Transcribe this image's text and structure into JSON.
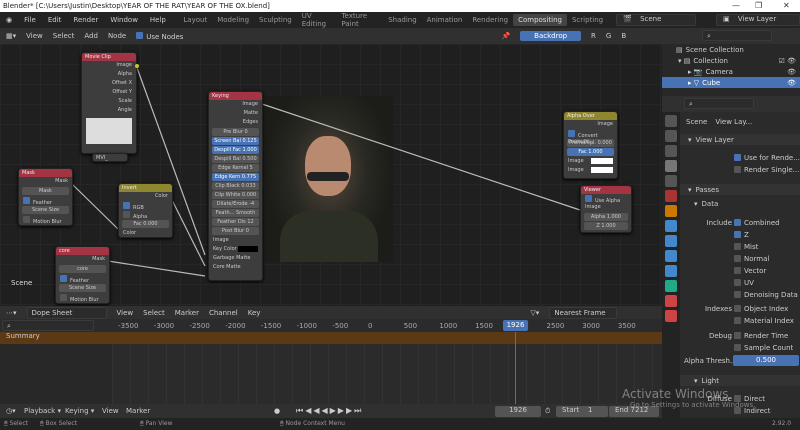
{
  "window_title": "Blender* [C:\\Users\\Justin\\Desktop\\YEAR OF THE RAT\\YEAR OF THE OX.blend]",
  "menu": [
    "File",
    "Edit",
    "Render",
    "Window",
    "Help"
  ],
  "workspaces": [
    "Layout",
    "Modeling",
    "Sculpting",
    "UV Editing",
    "Texture Paint",
    "Shading",
    "Animation",
    "Rendering",
    "Compositing",
    "Scripting"
  ],
  "active_workspace": "Compositing",
  "scene": "Scene",
  "view_layer": "View Layer",
  "node_header": {
    "menus": [
      "View",
      "Select",
      "Add",
      "Node"
    ],
    "use_nodes": "Use Nodes",
    "backdrop": "Backdrop",
    "channels": [
      "R",
      "G",
      "B"
    ]
  },
  "nodes": {
    "movie_clip": {
      "title": "Movie Clip",
      "outputs": [
        "Image",
        "Alpha",
        "Offset X",
        "Offset Y",
        "Scale",
        "Angle"
      ],
      "clip": "MVI_"
    },
    "mask": {
      "title": "Mask",
      "output": "Mask",
      "mask": "Mask",
      "feather": "Feather",
      "size": "Scene Size",
      "motion_blur": "Motion Blur"
    },
    "core": {
      "title": "core",
      "output": "Mask",
      "mask": "core",
      "feather": "Feather",
      "size": "Scene Size",
      "motion_blur": "Motion Blur"
    },
    "invert": {
      "title": "Invert",
      "output": "Color",
      "rgb": "RGB",
      "alpha": "Alpha",
      "fac_label": "Fac",
      "fac": "0.000",
      "input": "Color"
    },
    "keying": {
      "title": "Keying",
      "outputs": [
        "Image",
        "Matte",
        "Edges"
      ],
      "fields": [
        [
          "Pre Blur",
          "0"
        ],
        [
          "Screen Bal",
          "0.125"
        ],
        [
          "Despill Fac",
          "1.000"
        ],
        [
          "Despill Bal",
          "0.500"
        ],
        [
          "Edge Kernel",
          "5"
        ],
        [
          "Edge Kern",
          "0.775"
        ],
        [
          "Clip Black",
          "0.033"
        ],
        [
          "Clip White",
          "0.000"
        ],
        [
          "Dilate/Erode",
          "-4"
        ],
        [
          "Feath...",
          "Smooth"
        ],
        [
          "Feather Dis",
          "12"
        ],
        [
          "Post Blur",
          "0"
        ]
      ],
      "inputs": [
        "Image",
        "Key Color",
        "Garbage Matte",
        "Core Matte"
      ]
    },
    "alpha_over": {
      "title": "Alpha Over",
      "output": "Image",
      "convert": "Convert Premulti...",
      "premul_label": "Premultipl.",
      "premul": "0.000",
      "fac_label": "Fac",
      "fac": "1.000",
      "inputs": [
        "Image",
        "Image"
      ]
    },
    "viewer": {
      "title": "Viewer",
      "use_alpha": "Use Alpha",
      "input": "Image",
      "alpha_label": "Alpha",
      "alpha": "1.000",
      "z_label": "Z",
      "z": "1.000"
    }
  },
  "scene_label": "Scene",
  "outliner": {
    "items": [
      "Scene Collection",
      "Collection",
      "Camera",
      "Cube"
    ]
  },
  "properties": {
    "breadcrumb": [
      "Scene",
      "View Lay..."
    ],
    "view_layer": "View Layer",
    "use_render": "Use for Rende...",
    "render_single": "Render Single...",
    "passes": "Passes",
    "data": "Data",
    "include": "Include",
    "data_passes": [
      [
        "Combined",
        true
      ],
      [
        "Z",
        true
      ],
      [
        "Mist",
        false
      ],
      [
        "Normal",
        false
      ],
      [
        "Vector",
        false
      ],
      [
        "UV",
        false
      ],
      [
        "Denoising Data",
        false
      ]
    ],
    "indexes": "Indexes",
    "index_passes": [
      "Object Index",
      "Material Index"
    ],
    "debug": "Debug",
    "debug_passes": [
      "Render Time",
      "Sample Count"
    ],
    "alpha_label": "Alpha Thresh...",
    "alpha": "0.500",
    "light": "Light",
    "diffuse": "Diffuse",
    "light_passes": [
      "Direct",
      "Indirect"
    ]
  },
  "dopesheet": {
    "mode": "Dope Sheet",
    "menus": [
      "View",
      "Select",
      "Marker",
      "Channel",
      "Key"
    ],
    "snap": "Nearest Frame",
    "ticks": [
      -3500,
      -3000,
      -2500,
      -2000,
      -1500,
      -1000,
      -500,
      0,
      500,
      1000,
      1500,
      2000,
      2500,
      3000,
      3500
    ],
    "current": "1926",
    "summary": "Summary"
  },
  "timeline": {
    "menus": [
      "Playback",
      "Keying",
      "View",
      "Marker"
    ],
    "frame": "1926",
    "start_label": "Start",
    "start": "1",
    "end_label": "End",
    "end": "7212"
  },
  "status": {
    "items": [
      "Select",
      "Box Select",
      "Pan View",
      "Node Context Menu"
    ],
    "version": "2.92.0"
  },
  "watermark": {
    "title": "Activate Windows",
    "sub": "Go to Settings to activate Windows."
  }
}
